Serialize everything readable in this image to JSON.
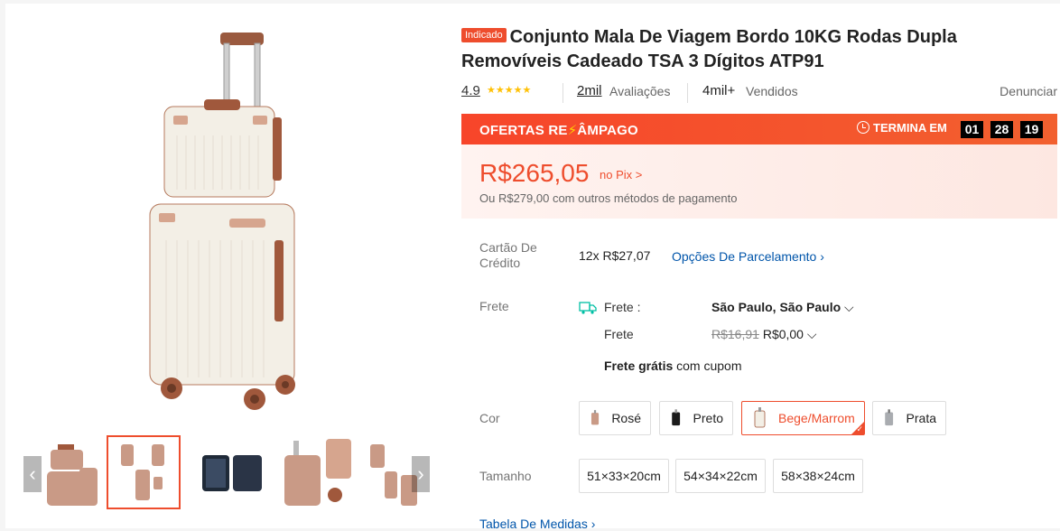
{
  "product": {
    "badge": "Indicado",
    "title": "Conjunto Mala De Viagem Bordo 10KG Rodas Dupla Removíveis Cadeado TSA 3 Dígitos ATP91"
  },
  "stats": {
    "rating": "4.9",
    "stars_icon": "star-icon",
    "reviews_count": "2mil",
    "reviews_label": "Avaliações",
    "sold_count": "4mil+",
    "sold_label": "Vendidos",
    "report": "Denunciar"
  },
  "flash_sale": {
    "title_part1": "OFERTAS RE",
    "title_part2": "ÂMPAGO",
    "ends_label": "TERMINA EM",
    "hours": "01",
    "minutes": "28",
    "seconds": "19"
  },
  "price": {
    "value": "R$265,05",
    "pix_label": "no Pix >",
    "other_methods": "Ou R$279,00 com outros métodos de pagamento"
  },
  "credit": {
    "label": "Cartão De Crédito",
    "installment": "12x R$27,07",
    "options_link": "Opções De Parcelamento"
  },
  "shipping": {
    "label": "Frete",
    "to_label": "Frete :",
    "location": "São Paulo, São Paulo",
    "cost_label": "Frete",
    "old_cost": "R$16,91",
    "new_cost": "R$0,00",
    "free_bold": "Frete grátis",
    "free_rest": "com cupom"
  },
  "color": {
    "label": "Cor",
    "options": [
      "Rosé",
      "Preto",
      "Bege/Marrom",
      "Prata"
    ],
    "selected": "Bege/Marrom"
  },
  "size": {
    "label": "Tamanho",
    "options": [
      "51×33×20cm",
      "54×34×22cm",
      "58×38×24cm"
    ]
  },
  "size_chart_link": "Tabela De Medidas",
  "colors": {
    "accent": "#ee4d2d",
    "link": "#0055aa",
    "star": "#ffc107",
    "suitcase_cream": "#f3efe6",
    "suitcase_rose": "#c99a86",
    "trim_brown": "#a0583c"
  }
}
